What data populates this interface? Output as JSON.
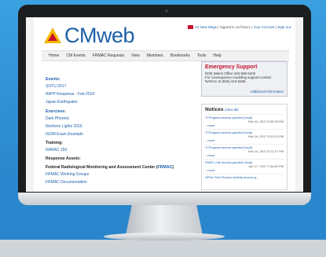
{
  "site": {
    "logo_text": "CMweb"
  },
  "toplinks": {
    "new_msgs": "12 New Msgs",
    "signed_in": "Signed in as fmac1",
    "account": "Your Account",
    "signout": "Sign out",
    "sep": "|"
  },
  "nav": [
    "Home",
    "CM Events",
    "FRMAC Requests",
    "View",
    "Members",
    "Bookmarks",
    "Tools",
    "Help"
  ],
  "left": {
    "events_h": "Events:",
    "events": [
      "SOTU 2017",
      "WIPP Response - Feb 2014",
      "Japan Earthquake"
    ],
    "exercises_h": "Exercises:",
    "exercises": [
      "Dark Phoenix",
      "Northern Lights 2016",
      "ISOM Exam Example"
    ],
    "training_h": "Training:",
    "training": [
      "NARAC 150"
    ],
    "response_h": "Response Assets:",
    "federal_h": "Federal Radiological Monitoring and Assessment Center (",
    "federal_link": "FRMAC",
    "federal_close": ")",
    "federal": [
      "FRMAC Working Groups",
      "FRMAC Documentation"
    ]
  },
  "emergency": {
    "title": "Emergency Support",
    "lines": [
      "DOE Watch Office 202-586-8100",
      "For consequence modeling support contact",
      "NARAC at (925) 424-6465."
    ],
    "more": "Additional Information"
  },
  "notices": {
    "title": "Notices",
    "view_all": "(view all)",
    "items": [
      {
        "title": "Tl Program access granted (local)",
        "date": "Feb 14, 2017 8:35:06 PM",
        "more": "...more"
      },
      {
        "title": "Tl Program access granted (local)",
        "date": "Feb 14, 2017 8:31:23 PM",
        "more": "...more"
      },
      {
        "title": "Tl Program access granted (local)",
        "date": "Feb 14, 2017 8:21:17 PM",
        "more": "...more"
      },
      {
        "title": "FAMS_Call access granted (local)",
        "date": "Jan 17, 2017 1:44:40 PM",
        "more": "...more"
      },
      {
        "title": "HPGe Field Source Activity access g...",
        "date": "",
        "more": ""
      }
    ]
  },
  "colors": {
    "accent": "#1c5fa8",
    "alert": "#c8102e",
    "background": "#2a86cc"
  }
}
